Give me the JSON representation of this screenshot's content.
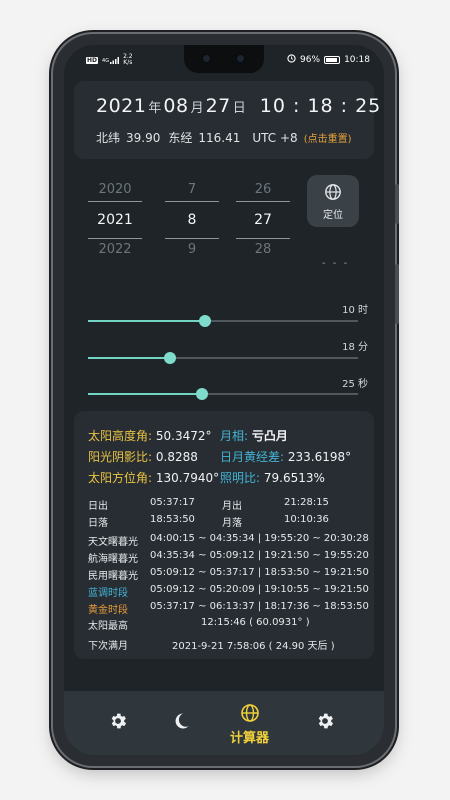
{
  "status_bar": {
    "hd": "HD",
    "signal": "4G",
    "net_speed_value": "2.2",
    "net_speed_unit": "K/s",
    "battery": "96%",
    "time": "10:18"
  },
  "date_header": {
    "year": "2021",
    "year_unit": "年",
    "month": "08",
    "month_unit": "月",
    "day": "27",
    "day_unit": "日",
    "time": "10 : 18 : 25",
    "lat_label": "北纬",
    "lat_value": "39.90",
    "lon_label": "东经",
    "lon_value": "116.41",
    "utc": "UTC +8",
    "reset": "(点击重置)"
  },
  "pickers": {
    "year": {
      "prev": "2020",
      "selected": "2021",
      "next": "2022"
    },
    "month": {
      "prev": "7",
      "selected": "8",
      "next": "9"
    },
    "day": {
      "prev": "26",
      "selected": "27",
      "next": "28"
    }
  },
  "locate_button": {
    "label": "定位",
    "icon": "globe-icon"
  },
  "dashes": "- - -",
  "sliders": [
    {
      "label": "10 时",
      "value": 10,
      "max": 23
    },
    {
      "label": "18 分",
      "value": 18,
      "max": 59
    },
    {
      "label": "25 秒",
      "value": 25,
      "max": 59
    }
  ],
  "info": {
    "sun_altitude_label": "太阳高度角:",
    "sun_altitude": "50.3472°",
    "moon_phase_label": "月相:",
    "moon_phase": "亏凸月",
    "shadow_ratio_label": "阳光阴影比:",
    "shadow_ratio": "0.8288",
    "ecliptic_diff_label": "日月黄经差:",
    "ecliptic_diff": "233.6198°",
    "sun_azimuth_label": "太阳方位角:",
    "sun_azimuth": "130.7940°",
    "illumination_label": "照明比:",
    "illumination": "79.6513%",
    "sunrise_label": "日出",
    "sunrise": "05:37:17",
    "moonrise_label": "月出",
    "moonrise": "21:28:15",
    "sunset_label": "日落",
    "sunset": "18:53:50",
    "moonset_label": "月落",
    "moonset": "10:10:36",
    "astro_twilight_label": "天文曙暮光",
    "astro_twilight": "04:00:15 ~ 04:35:34 | 19:55:20 ~ 20:30:28",
    "nautical_twilight_label": "航海曙暮光",
    "nautical_twilight": "04:35:34 ~ 05:09:12 | 19:21:50 ~ 19:55:20",
    "civil_twilight_label": "民用曙暮光",
    "civil_twilight": "05:09:12 ~ 05:37:17 | 18:53:50 ~ 19:21:50",
    "blue_hour_label": "蓝调时段",
    "blue_hour": "05:09:12 ~ 05:20:09 | 19:10:55 ~ 19:21:50",
    "golden_hour_label": "黄金时段",
    "golden_hour": "05:37:17 ~ 06:13:37 | 18:17:36 ~ 18:53:50",
    "solar_noon_label": "太阳最高",
    "solar_noon": "12:15:46 ( 60.0931° )",
    "next_full_moon_label": "下次满月",
    "next_full_moon": "2021-9-21  7:58:06 ( 24.90 天后 )"
  },
  "bottom_nav": {
    "items": [
      {
        "icon": "gear-icon"
      },
      {
        "icon": "moon-icon"
      },
      {
        "icon": "globe-icon",
        "label": "计算器",
        "active": true
      },
      {
        "icon": "gear-icon"
      }
    ],
    "active_color": "#f1d23a"
  },
  "colors": {
    "accent": "#74d4c4",
    "label_yellow": "#eac443",
    "label_cyan": "#43b4d4",
    "label_orange": "#e89a3a",
    "reset_orange": "#e5a23c"
  }
}
